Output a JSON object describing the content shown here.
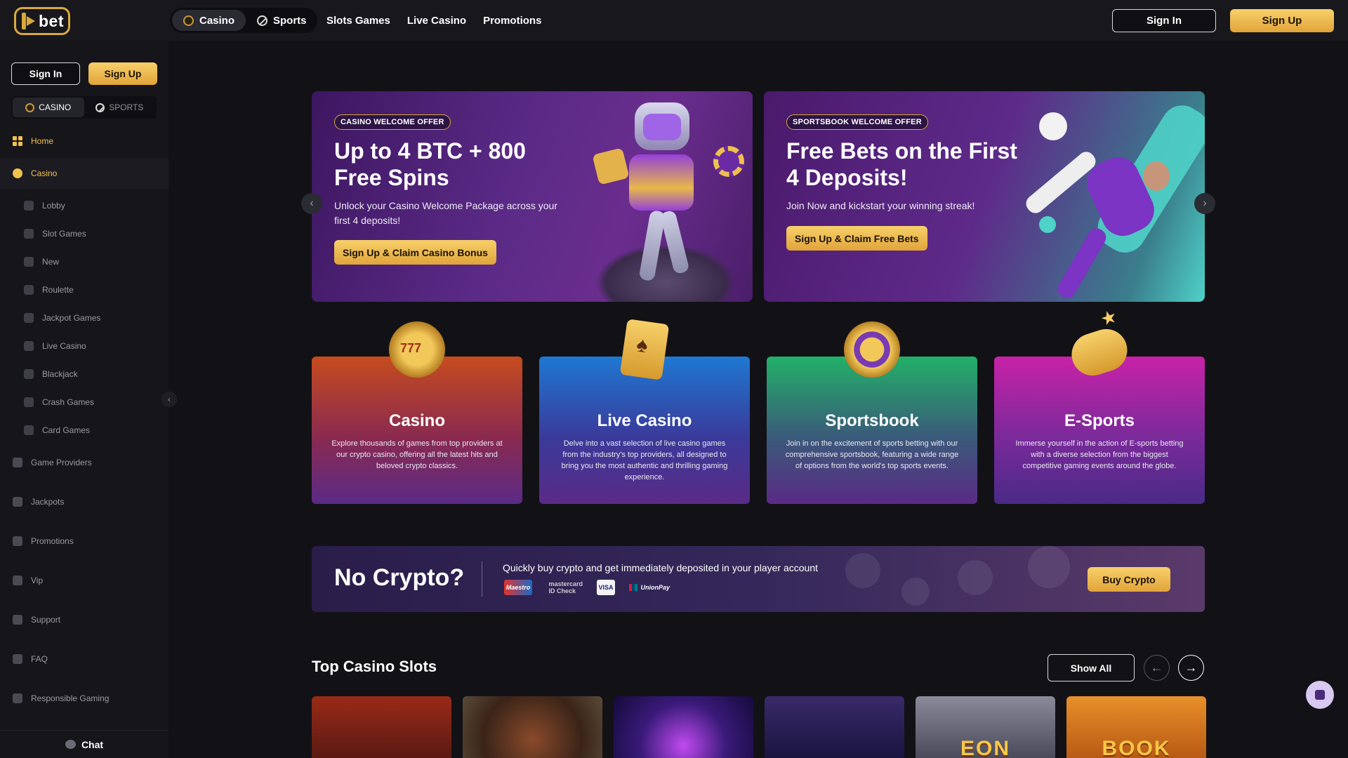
{
  "brand": {
    "logo_text": "bet",
    "accent": "#e1a43a"
  },
  "header": {
    "modes": [
      {
        "label": "Casino",
        "icon": "casino-coin-icon",
        "active": true
      },
      {
        "label": "Sports",
        "icon": "football-icon",
        "active": false
      }
    ],
    "nav": [
      "Slots Games",
      "Live Casino",
      "Promotions"
    ],
    "sign_in": "Sign In",
    "sign_up": "Sign Up"
  },
  "sidebar": {
    "sign_in": "Sign In",
    "sign_up": "Sign Up",
    "modes": [
      {
        "label": "CASINO",
        "active": true
      },
      {
        "label": "SPORTS",
        "active": false
      }
    ],
    "items": [
      {
        "label": "Home",
        "icon": "home-grid-icon",
        "active": true
      },
      {
        "label": "Casino",
        "icon": "casino-chips-icon",
        "highlight": true
      },
      {
        "label": "Lobby",
        "icon": "lobby-icon"
      },
      {
        "label": "Slot Games",
        "icon": "slot-machine-icon"
      },
      {
        "label": "New",
        "icon": "new-icon"
      },
      {
        "label": "Roulette",
        "icon": "roulette-icon"
      },
      {
        "label": "Jackpot Games",
        "icon": "jackpot-icon"
      },
      {
        "label": "Live Casino",
        "icon": "live-casino-icon"
      },
      {
        "label": "Blackjack",
        "icon": "blackjack-icon"
      },
      {
        "label": "Crash Games",
        "icon": "crash-icon"
      },
      {
        "label": "Card Games",
        "icon": "cards-icon"
      },
      {
        "label": "Game Providers",
        "icon": "providers-icon"
      },
      {
        "label": "Jackpots",
        "icon": "jackpots-icon"
      },
      {
        "label": "Promotions",
        "icon": "promotions-icon"
      },
      {
        "label": "Vip",
        "icon": "vip-icon"
      },
      {
        "label": "Support",
        "icon": "support-icon"
      },
      {
        "label": "FAQ",
        "icon": "faq-icon"
      },
      {
        "label": "Responsible Gaming",
        "icon": "responsible-gaming-icon"
      }
    ],
    "chat": "Chat"
  },
  "banners": [
    {
      "badge": "CASINO WELCOME OFFER",
      "title": "Up to 4 BTC + 800 Free Spins",
      "desc": "Unlock your Casino Welcome Package across your first 4 deposits!",
      "cta": "Sign Up & Claim Casino Bonus"
    },
    {
      "badge": "SPORTSBOOK WELCOME OFFER",
      "title": "Free Bets on the First 4 Deposits!",
      "desc": "Join Now and kickstart your winning streak!",
      "cta": "Sign Up & Claim Free Bets"
    }
  ],
  "categories": [
    {
      "title": "Casino",
      "desc": "Explore thousands of games from top providers at our crypto casino, offering all the latest hits and beloved crypto classics."
    },
    {
      "title": "Live Casino",
      "desc": "Delve into a vast selection of live casino games from the industry's top providers, all designed to bring you the most authentic and thrilling gaming experience."
    },
    {
      "title": "Sportsbook",
      "desc": "Join in on the excitement of sports betting with our comprehensive sportsbook, featuring a wide range of options from the world's top sports events."
    },
    {
      "title": "E-Sports",
      "desc": "Immerse yourself in the action of E-sports betting with a diverse selection from the biggest competitive gaming events around the globe."
    }
  ],
  "crypto": {
    "title": "No Crypto?",
    "desc": "Quickly buy crypto and get immediately deposited in your player account",
    "payments": [
      "Maestro",
      "mastercard ID Check",
      "VISA",
      "UnionPay"
    ],
    "button": "Buy Crypto"
  },
  "slots": {
    "title": "Top Casino Slots",
    "show_all": "Show All",
    "tiles": [
      {
        "label": ""
      },
      {
        "label": ""
      },
      {
        "label": ""
      },
      {
        "label": ""
      },
      {
        "label": "EON"
      },
      {
        "label": "BOOK"
      }
    ]
  }
}
